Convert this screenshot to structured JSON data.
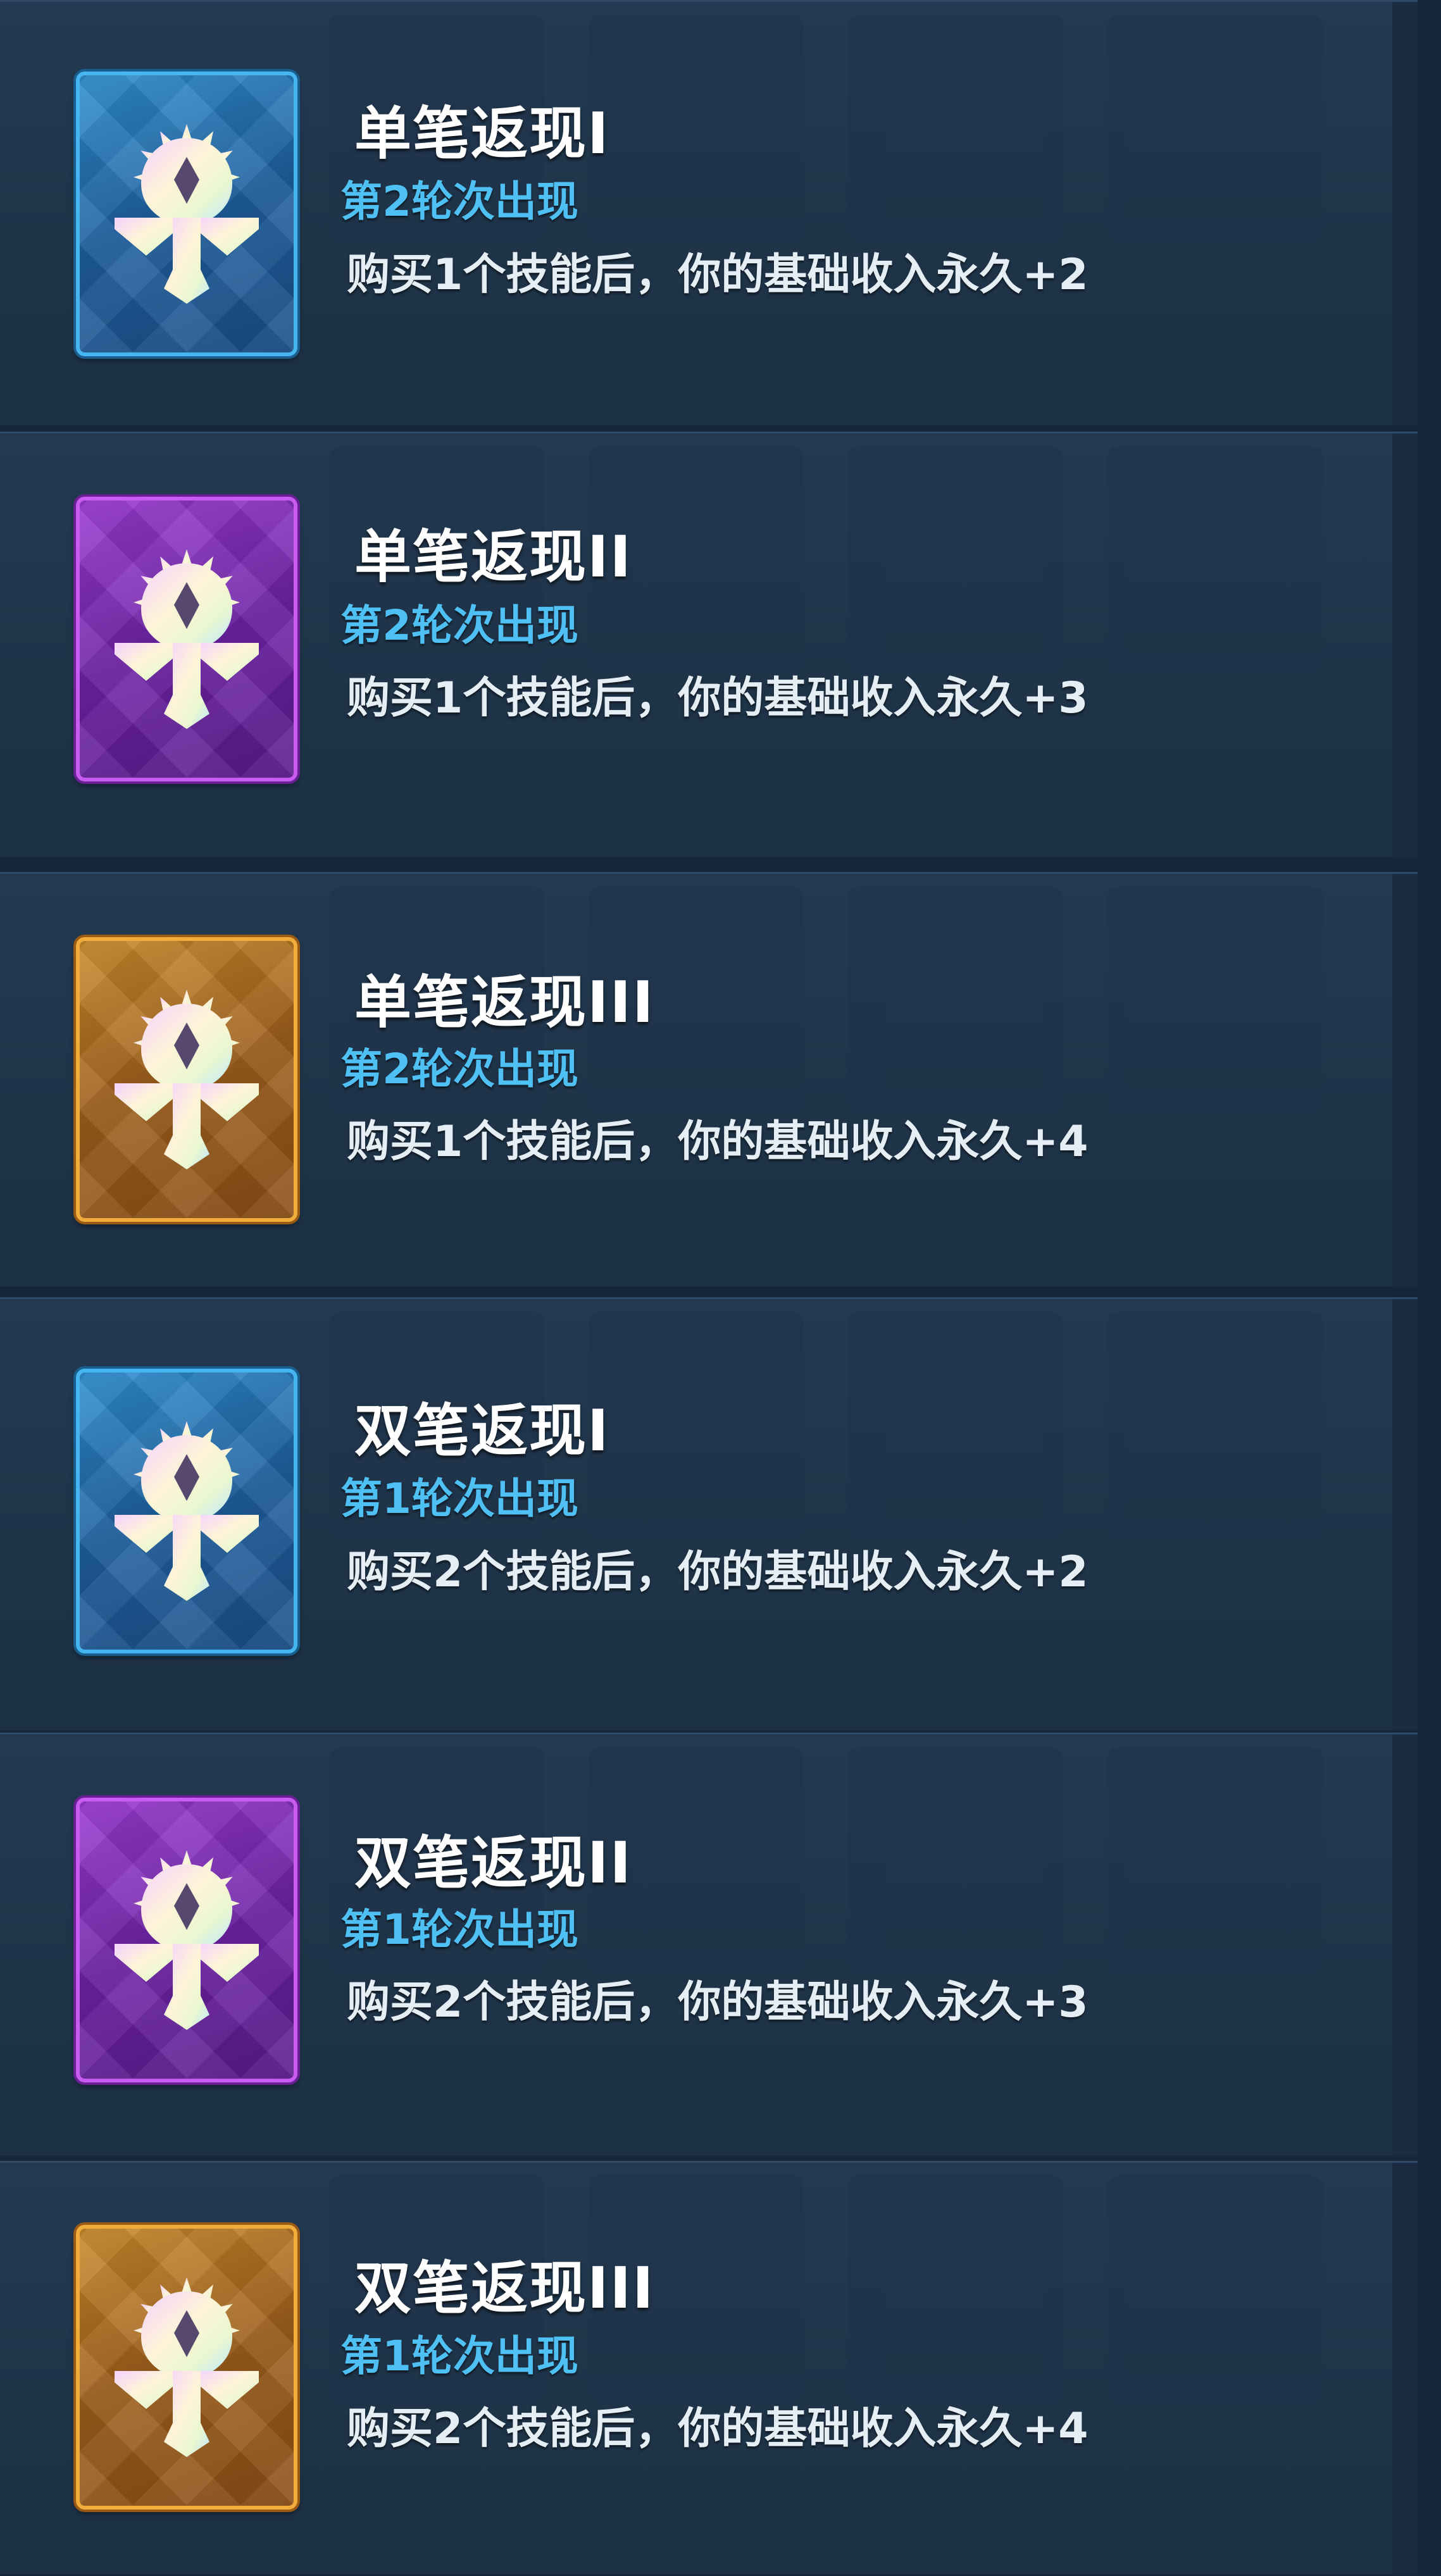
{
  "cards": [
    {
      "title": "单笔返现I",
      "round": "第2轮次出现",
      "description": "购买1个技能后，你的基础收入永久+2",
      "rarity": "blue",
      "icon": "scale-sun-icon"
    },
    {
      "title": "单笔返现II",
      "round": "第2轮次出现",
      "description": "购买1个技能后，你的基础收入永久+3",
      "rarity": "purple",
      "icon": "scale-sun-icon"
    },
    {
      "title": "单笔返现III",
      "round": "第2轮次出现",
      "description": "购买1个技能后，你的基础收入永久+4",
      "rarity": "orange",
      "icon": "scale-sun-icon"
    },
    {
      "title": "双笔返现I",
      "round": "第1轮次出现",
      "description": "购买2个技能后，你的基础收入永久+2",
      "rarity": "blue",
      "icon": "scale-sun-icon"
    },
    {
      "title": "双笔返现II",
      "round": "第1轮次出现",
      "description": "购买2个技能后，你的基础收入永久+3",
      "rarity": "purple",
      "icon": "scale-sun-icon"
    },
    {
      "title": "双笔返现III",
      "round": "第1轮次出现",
      "description": "购买2个技能后，你的基础收入永久+4",
      "rarity": "orange",
      "icon": "scale-sun-icon"
    }
  ],
  "colors": {
    "title": "#ffffff",
    "round": "#4fc0f4",
    "description": "#e6eef5",
    "blue": "#46b6f0",
    "purple": "#c85cf0",
    "orange": "#f0ad3c"
  }
}
